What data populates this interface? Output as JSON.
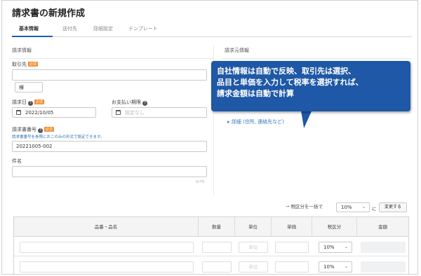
{
  "page": {
    "title": "請求書の新規作成"
  },
  "tabs": [
    {
      "label": "基本情報",
      "active": true
    },
    {
      "label": "送付先",
      "active": false
    },
    {
      "label": "詳細設定",
      "active": false
    },
    {
      "label": "テンプレート",
      "active": false
    }
  ],
  "left": {
    "section_title": "請求情報",
    "client": {
      "label": "取引先",
      "required": "必須",
      "suffix_value": "様"
    },
    "invoice_date": {
      "label": "請求日",
      "required": "必須",
      "value": "2022/10/05"
    },
    "due_date": {
      "label": "お支払い期限",
      "placeholder": "設定なし"
    },
    "invoice_number": {
      "label": "請求書番号",
      "required": "必須",
      "hint": "請求書番号を参照におこのみの形式で設定できます。",
      "value": "20221005-002"
    },
    "subject": {
      "label": "件名",
      "count": "0/70"
    }
  },
  "right": {
    "section_title": "請求元情報",
    "detail_link": "詳細 (住所, 連絡先など)"
  },
  "callout": {
    "lines": [
      "自社情報は自動で反映、取引先は選択、",
      "品目と単価を入力して税率を選択すれば、",
      "請求金額は自動で計算"
    ]
  },
  "tax_bar": {
    "label": "税区分を一括で",
    "value": "10%",
    "suffix": "に",
    "button": "変更する"
  },
  "table": {
    "headers": [
      "品番・品名",
      "数量",
      "単位",
      "単価",
      "税区分",
      "金額"
    ],
    "unit_placeholder": "単位",
    "rows": [
      {
        "tax": "10%"
      },
      {
        "tax": "10%"
      }
    ]
  },
  "colors": {
    "accent": "#1e58a6",
    "required_badge": "#f08c2e",
    "link": "#2d76b8"
  }
}
